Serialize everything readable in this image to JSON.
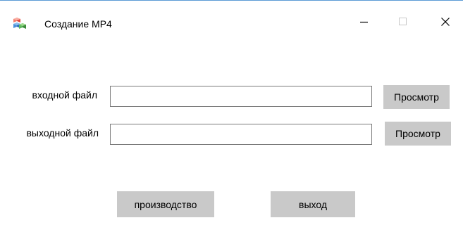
{
  "window": {
    "title": "Создание MP4",
    "app_icon": "colored-cubes-icon",
    "controls": {
      "minimize_icon": "minimize-icon",
      "maximize_icon": "maximize-icon",
      "close_icon": "close-icon"
    }
  },
  "form": {
    "input_label": "входной файл",
    "input_value": "",
    "input_browse_label": "Просмотр",
    "output_label": "выходной файл",
    "output_value": "",
    "output_browse_label": "Просмотр"
  },
  "actions": {
    "produce_label": "производство",
    "exit_label": "выход"
  },
  "colors": {
    "window_border": "#5b9bd5",
    "button_bg": "#c9c9c9",
    "field_border": "#7a7a7a"
  }
}
